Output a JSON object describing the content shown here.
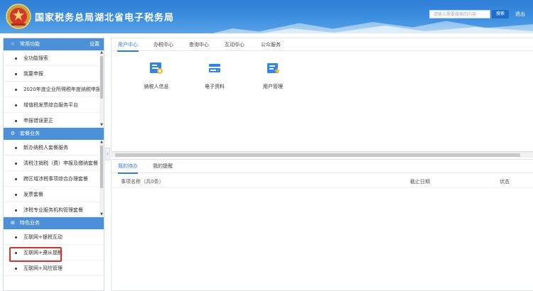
{
  "header": {
    "title": "国家税务总局湖北省电子税务局",
    "search_placeholder": "请输入需要搜索的内容",
    "search_button": "搜索",
    "exit_label": "退出",
    "emblem_icon": "tax-emblem"
  },
  "sidebar": {
    "sections": [
      {
        "title": "常用功能",
        "icon": "star-icon",
        "settings_label": "设置",
        "items": [
          {
            "label": "全功能搜索"
          },
          {
            "label": "我要申报"
          },
          {
            "label": "2020年度企业所得税年度纳税申报"
          },
          {
            "label": "增值税发票综合服务平台"
          },
          {
            "label": "申报错误更正"
          }
        ]
      },
      {
        "title": "套餐业务",
        "icon": "gear-icon",
        "items": [
          {
            "label": "新办纳税人套餐服务"
          },
          {
            "label": "清税注销税（费）申报及缴纳套餐"
          },
          {
            "label": "跨区域涉税事项综合办理套餐"
          },
          {
            "label": "发票套餐"
          },
          {
            "label": "涉税专业服务机构管理套餐"
          }
        ]
      },
      {
        "title": "特色业务",
        "icon": "grid-icon",
        "items": [
          {
            "label": "互联网+银税互动"
          },
          {
            "label": "互联网+遵从提醒"
          },
          {
            "label": "互联网+风险管理"
          }
        ]
      }
    ]
  },
  "main": {
    "top_tabs": [
      "用户中心",
      "办税中心",
      "查询中心",
      "互动中心",
      "公众服务"
    ],
    "active_top_tab": 0,
    "apps": [
      {
        "label": "纳税人信息",
        "icon": "taxpayer-info-icon"
      },
      {
        "label": "电子资料",
        "icon": "electronic-data-icon"
      },
      {
        "label": "用户管理",
        "icon": "user-management-icon"
      }
    ],
    "bottom_tabs": [
      "我的待办",
      "我的提醒"
    ],
    "active_bottom_tab": 0,
    "table": {
      "columns": [
        "事项名称（共0条）",
        "截止日期",
        "状态"
      ]
    }
  },
  "colors": {
    "header_blue": "#3d8fe0",
    "section_header": "#4c90d8",
    "accent": "#2c7be5",
    "highlight_red": "#d9322a"
  }
}
